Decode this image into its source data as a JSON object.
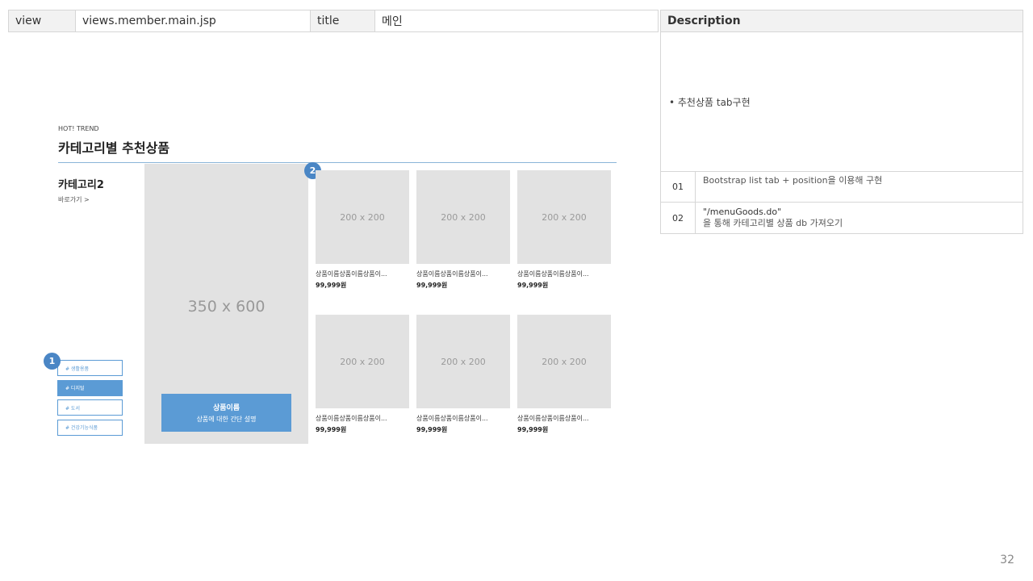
{
  "header": {
    "view_label": "view",
    "view_value": "views.member.main.jsp",
    "title_label": "title",
    "title_value": "메인"
  },
  "description": {
    "heading": "Description",
    "bullet": "• 추천상품 tab구현",
    "rows": [
      {
        "num": "01",
        "line1": "Bootstrap list tab + position을 이용해 구현",
        "line2": ""
      },
      {
        "num": "02",
        "line1": "\"/menuGoods.do\"",
        "line2": "을 통해 카테고리별 상품 db 가져오기"
      }
    ]
  },
  "mockup": {
    "subtitle": "HOT! TREND",
    "title": "카테고리별 추천상품",
    "category_name": "카테고리2",
    "category_link": "바로가기 >",
    "big_image_placeholder": "350 x 600",
    "banner_title": "상품이름",
    "banner_desc": "상품에 대한 간단 설명",
    "tabs": [
      {
        "label": "# 생활용품",
        "active": false
      },
      {
        "label": "# 디지털",
        "active": true
      },
      {
        "label": "# 도서",
        "active": false
      },
      {
        "label": "# 건강기능식품",
        "active": false
      }
    ],
    "badges": [
      "1",
      "2"
    ],
    "products": [
      {
        "placeholder": "200 x 200",
        "name": "상품이름상품이름상품이...",
        "price": "99,999원"
      },
      {
        "placeholder": "200 x 200",
        "name": "상품이름상품이름상품이...",
        "price": "99,999원"
      },
      {
        "placeholder": "200 x 200",
        "name": "상품이름상품이름상품이...",
        "price": "99,999원"
      },
      {
        "placeholder": "200 x 200",
        "name": "상품이름상품이름상품이...",
        "price": "99,999원"
      },
      {
        "placeholder": "200 x 200",
        "name": "상품이름상품이름상품이...",
        "price": "99,999원"
      },
      {
        "placeholder": "200 x 200",
        "name": "상품이름상품이름상품이...",
        "price": "99,999원"
      }
    ]
  },
  "page_number": "32",
  "colors": {
    "accent": "#5b9bd5",
    "badge": "#4a86c5",
    "placeholder_bg": "#e2e2e2"
  }
}
